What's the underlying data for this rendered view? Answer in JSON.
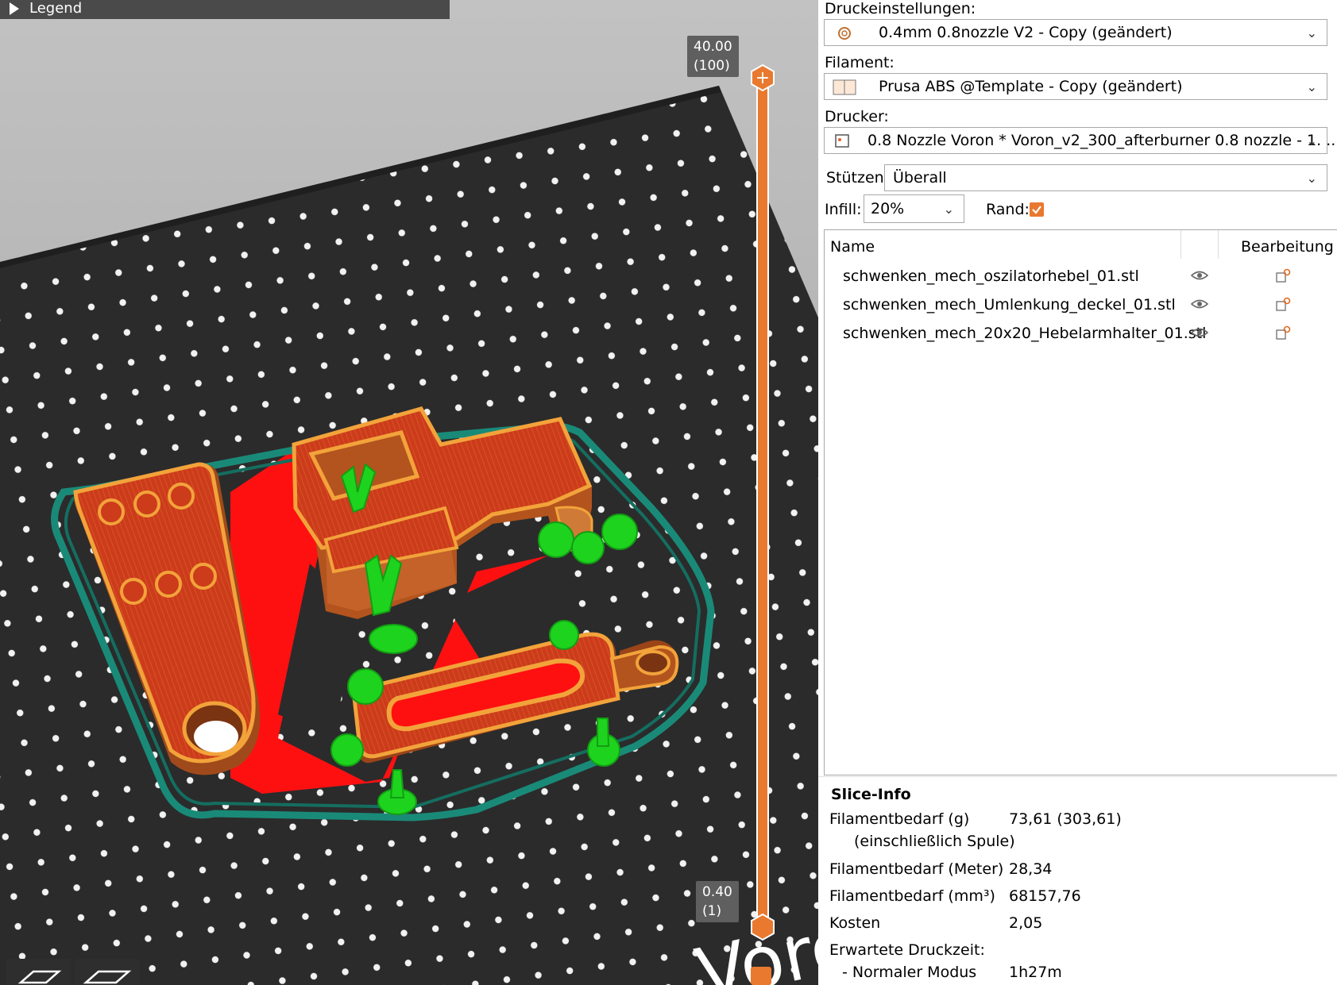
{
  "legend": {
    "label": "Legend"
  },
  "layer_slider": {
    "top_height": "40.00",
    "top_layer": "(100)",
    "bottom_height": "0.40",
    "bottom_layer": "(1)"
  },
  "settings": {
    "print_settings_label": "Druckeinstellungen:",
    "print_settings_value": "0.4mm 0.8nozzle V2 - Copy (geändert)",
    "filament_label": "Filament:",
    "filament_value": "Prusa ABS @Template - Copy (geändert)",
    "printer_label": "Drucker:",
    "printer_value": "0.8 Nozzle Voron  * Voron_v2_300_afterburner 0.8 nozzle - 1. ...",
    "supports_label": "Stützen:",
    "supports_value": "Überall",
    "infill_label": "Infill:",
    "infill_value": "20%",
    "brim_label": "Rand:",
    "brim_checked": true
  },
  "object_list": {
    "col_name": "Name",
    "col_edit": "Bearbeitung",
    "items": [
      {
        "name": "schwenken_mech_oszilatorhebel_01.stl"
      },
      {
        "name": "schwenken_mech_Umlenkung_deckel_01.stl"
      },
      {
        "name": "schwenken_mech_20x20_Hebelarmhalter_01.stl"
      }
    ]
  },
  "slice_info": {
    "title": "Slice-Info",
    "rows": [
      {
        "label": "Filamentbedarf (g)",
        "value": "73,61 (303,61)"
      },
      {
        "label": "(einschließlich Spule)",
        "value": ""
      },
      {
        "label": "Filamentbedarf (Meter)",
        "value": "28,34"
      },
      {
        "label": "Filamentbedarf (mm³)",
        "value": "68157,76"
      },
      {
        "label": "Kosten",
        "value": "2,05"
      },
      {
        "label": "Erwartete Druckzeit:",
        "value": ""
      },
      {
        "label": "- Normaler Modus",
        "value": "1h27m"
      }
    ]
  },
  "bed_logo_text": "Voron",
  "colors": {
    "part_outer_wall": "#e08a2a",
    "part_infill": "#cc3b1a",
    "support": "#1ed31e",
    "brim": "#1a8a78",
    "bed": "#2b2b2b",
    "accent": "#e8792f"
  }
}
